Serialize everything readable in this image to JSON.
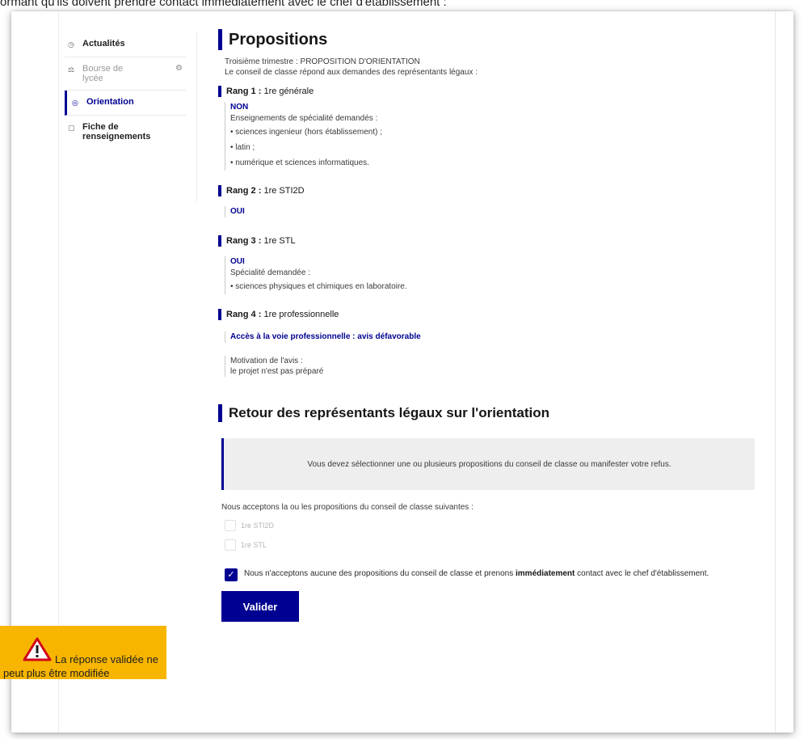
{
  "top_text": "ormant qu'ils doivent prendre contact immédiatement avec le chef d'établissement :",
  "sidebar": {
    "items": [
      {
        "label": "Actualités"
      },
      {
        "label": "Bourse de lycée"
      },
      {
        "label": "Orientation"
      },
      {
        "label": "Fiche de renseignements"
      }
    ]
  },
  "main": {
    "title": "Propositions",
    "intro_line1": "Troisième trimestre : PROPOSITION D'ORIENTATION",
    "intro_line2": "Le conseil de classe répond aux demandes des représentants légaux :",
    "ranks": [
      {
        "rank": "Rang 1 :",
        "choice": "1re générale",
        "verdict": "NON",
        "spec_label": "Enseignements de spécialité demandés :",
        "specs": [
          "sciences ingenieur (hors établissement) ;",
          "latin ;",
          "numérique et sciences informatiques."
        ]
      },
      {
        "rank": "Rang 2 :",
        "choice": "1re STI2D",
        "verdict": "OUI"
      },
      {
        "rank": "Rang 3 :",
        "choice": "1re STL",
        "verdict": "OUI",
        "spec_label": "Spécialité demandée :",
        "specs": [
          "sciences physiques et chimiques en laboratoire."
        ]
      },
      {
        "rank": "Rang 4 :",
        "choice": "1re professionnelle",
        "verdict": "Accès à la voie professionnelle : avis défavorable",
        "motivation_label": "Motivation de l'avis :",
        "motivation": "le projet n'est pas préparé"
      }
    ],
    "section2_title": "Retour des représentants légaux sur l'orientation",
    "alert_text": "Vous devez sélectionner une ou plusieurs propositions du conseil de classe ou manifester votre refus.",
    "accept_label": "Nous acceptons la ou les propositions du conseil de classe suivantes :",
    "options": [
      "1re STI2D",
      "1re STL"
    ],
    "refuse_pre": "Nous n'acceptons aucune des propositions du conseil de classe et prenons ",
    "refuse_bold": "immédiatement",
    "refuse_post": " contact avec le chef d'établissement.",
    "submit_label": "Valider"
  },
  "warning": {
    "line1": "La réponse validée ne",
    "line2": "peut plus être modifiée"
  },
  "colors": {
    "primary": "#000091",
    "warning": "#f7b500",
    "alert_bg": "#eeeeee"
  }
}
